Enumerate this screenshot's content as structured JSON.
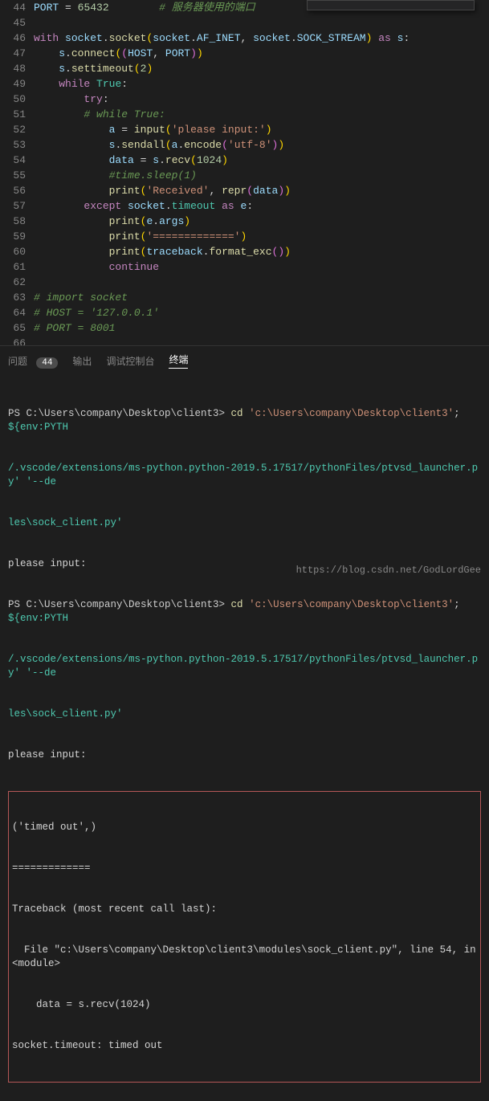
{
  "editor": {
    "lines": [
      {
        "n": 44,
        "h": "<span class='vr'>PORT</span> <span class='op'>=</span> <span class='num'>65432</span>        <span class='cm'># 服务器使用的端口</span>"
      },
      {
        "n": 45,
        "h": ""
      },
      {
        "n": 46,
        "h": "<span class='kw'>with</span> <span class='vr'>socket</span>.<span class='fn'>socket</span><span class='pn'>(</span><span class='vr'>socket</span>.<span class='vr'>AF_INET</span>, <span class='vr'>socket</span>.<span class='vr'>SOCK_STREAM</span><span class='pn'>)</span> <span class='kw'>as</span> <span class='vr'>s</span>:"
      },
      {
        "n": 47,
        "h": "    <span class='vr'>s</span>.<span class='fn'>connect</span><span class='pn'>(</span><span class='pn2'>(</span><span class='vr'>HOST</span>, <span class='vr'>PORT</span><span class='pn2'>)</span><span class='pn'>)</span>"
      },
      {
        "n": 48,
        "h": "    <span class='vr'>s</span>.<span class='fn'>settimeout</span><span class='pn'>(</span><span class='num'>2</span><span class='pn'>)</span>"
      },
      {
        "n": 49,
        "h": "    <span class='kw'>while</span> <span class='cls'>True</span>:"
      },
      {
        "n": 50,
        "h": "        <span class='kw'>try</span>:"
      },
      {
        "n": 51,
        "h": "        <span class='cm'># while True:</span>"
      },
      {
        "n": 52,
        "h": "            <span class='vr'>a</span> <span class='op'>=</span> <span class='fn'>input</span><span class='pn'>(</span><span class='str'>'please input:'</span><span class='pn'>)</span>"
      },
      {
        "n": 53,
        "h": "            <span class='vr'>s</span>.<span class='fn'>sendall</span><span class='pn'>(</span><span class='vr'>a</span>.<span class='fn'>encode</span><span class='pn2'>(</span><span class='str'>'utf-8'</span><span class='pn2'>)</span><span class='pn'>)</span>"
      },
      {
        "n": 54,
        "h": "            <span class='vr'>data</span> <span class='op'>=</span> <span class='vr'>s</span>.<span class='fn'>recv</span><span class='pn'>(</span><span class='num'>1024</span><span class='pn'>)</span>"
      },
      {
        "n": 55,
        "h": "            <span class='cm'>#time.sleep(1)</span>"
      },
      {
        "n": 56,
        "h": "            <span class='fn'>print</span><span class='pn'>(</span><span class='str'>'Received'</span>, <span class='fn'>repr</span><span class='pn2'>(</span><span class='vr'>data</span><span class='pn2'>)</span><span class='pn'>)</span>"
      },
      {
        "n": 57,
        "h": "        <span class='kw'>except</span> <span class='vr'>socket</span>.<span class='cls'>timeout</span> <span class='kw'>as</span> <span class='vr'>e</span>:"
      },
      {
        "n": 58,
        "h": "            <span class='fn'>print</span><span class='pn'>(</span><span class='vr'>e</span>.<span class='vr'>args</span><span class='pn'>)</span>"
      },
      {
        "n": 59,
        "h": "            <span class='fn'>print</span><span class='pn'>(</span><span class='str'>'============='</span><span class='pn'>)</span>"
      },
      {
        "n": 60,
        "h": "            <span class='fn'>print</span><span class='pn'>(</span><span class='vr'>traceback</span>.<span class='fn'>format_exc</span><span class='pn2'>(</span><span class='pn2'>)</span><span class='pn'>)</span>"
      },
      {
        "n": 61,
        "h": "            <span class='kw'>continue</span>"
      },
      {
        "n": 62,
        "h": ""
      },
      {
        "n": 63,
        "h": "<span class='cm'># import socket</span>"
      },
      {
        "n": 64,
        "h": "<span class='cm'># HOST = '127.0.0.1'</span>"
      },
      {
        "n": 65,
        "h": "<span class='cm'># PORT = 8001</span>"
      },
      {
        "n": 66,
        "h": ""
      }
    ]
  },
  "tabs": {
    "problems": "问题",
    "problems_count": "44",
    "output": "输出",
    "debug": "调试控制台",
    "terminal": "终端"
  },
  "terminal": {
    "block1_prompt": "PS C:\\Users\\company\\Desktop\\client3> ",
    "block1_cmd": "cd ",
    "block1_path": "'c:\\Users\\company\\Desktop\\client3'",
    "block1_rest": "; ",
    "block1_env": "${env:PYTH",
    "block1_cont": "/.vscode/extensions/ms-python.python-2019.5.17517/pythonFiles/ptvsd_launcher.py' '--de",
    "block1_cont2": "les\\sock_client.py'",
    "please": "please input:",
    "err1": "('timed out',)",
    "err2": "=============",
    "err3": "Traceback (most recent call last):",
    "err4": "  File \"c:\\Users\\company\\Desktop\\client3\\modules\\sock_client.py\", line 54, in <module>",
    "err5": "    data = s.recv(1024)",
    "err6": "socket.timeout: timed out"
  },
  "watermark": "https://blog.csdn.net/GodLordGee"
}
